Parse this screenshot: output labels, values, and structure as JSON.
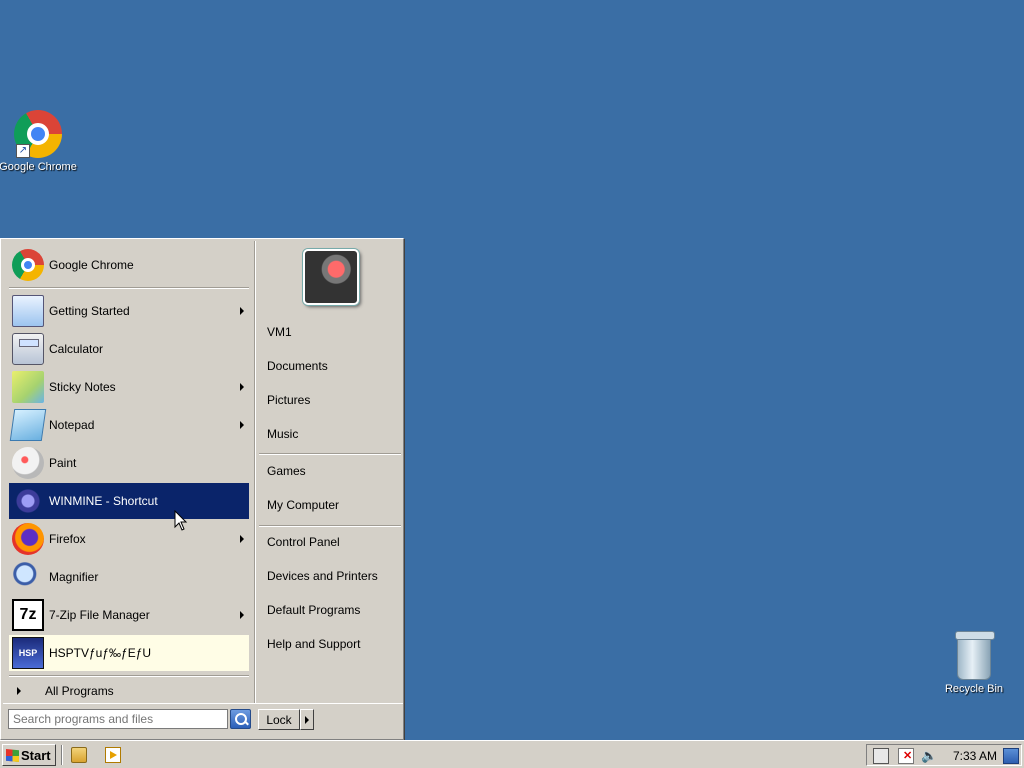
{
  "desktop": {
    "background_color": "#3a6ea5",
    "icons": [
      {
        "label": "Google Chrome",
        "icon": "chrome-icon"
      },
      {
        "label": "Recycle Bin",
        "icon": "recycle-bin-icon"
      }
    ]
  },
  "start_menu": {
    "pinned": {
      "label": "Google Chrome",
      "icon": "chrome-icon"
    },
    "recent": [
      {
        "label": "Getting Started",
        "icon": "getting-started-icon",
        "submenu": true
      },
      {
        "label": "Calculator",
        "icon": "calculator-icon",
        "submenu": false
      },
      {
        "label": "Sticky Notes",
        "icon": "sticky-notes-icon",
        "submenu": true
      },
      {
        "label": "Notepad",
        "icon": "notepad-icon",
        "submenu": true
      },
      {
        "label": "Paint",
        "icon": "paint-icon",
        "submenu": false
      },
      {
        "label": "WINMINE - Shortcut",
        "icon": "minesweeper-icon",
        "submenu": false,
        "selected": true
      },
      {
        "label": "Firefox",
        "icon": "firefox-icon",
        "submenu": true
      },
      {
        "label": "Magnifier",
        "icon": "magnifier-icon",
        "submenu": false
      },
      {
        "label": "7-Zip File Manager",
        "icon": "7zip-icon",
        "icon_text": "7z",
        "submenu": true
      },
      {
        "label": "HSPTVƒuƒ‰ƒEƒU",
        "icon": "hsptv-icon",
        "icon_text": "HSP",
        "submenu": false,
        "highlighted": true
      }
    ],
    "all_programs": "All Programs",
    "right_pane": {
      "group1": [
        "VM1",
        "Documents",
        "Pictures",
        "Music"
      ],
      "group2": [
        "Games",
        "My Computer"
      ],
      "group3": [
        "Control Panel",
        "Devices and Printers",
        "Default Programs",
        "Help and Support"
      ]
    },
    "search": {
      "placeholder": "Search programs and files"
    },
    "lock_label": "Lock",
    "selected_color": "#0a246a"
  },
  "taskbar": {
    "start_label": "Start",
    "clock": "7:33 AM",
    "quick_launch": [
      "explorer-icon",
      "media-player-icon"
    ],
    "tray_icons": [
      "network-icon",
      "security-alert-icon",
      "volume-icon",
      "show-desktop-icon"
    ]
  }
}
